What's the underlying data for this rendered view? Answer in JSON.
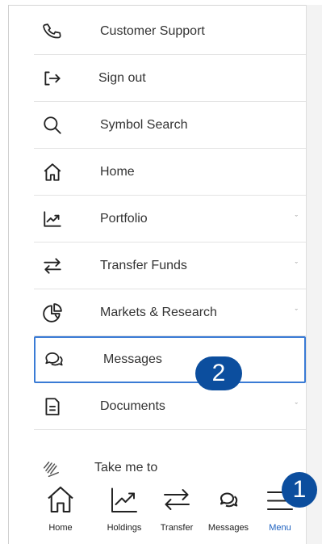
{
  "menu": {
    "items": [
      {
        "label": "Customer Support",
        "icon": "phone-icon",
        "chevron": false
      },
      {
        "label": "Sign out",
        "icon": "sign-out-icon",
        "chevron": false
      },
      {
        "label": "Symbol Search",
        "icon": "search-icon",
        "chevron": false
      },
      {
        "label": "Home",
        "icon": "home-icon",
        "chevron": false
      },
      {
        "label": "Portfolio",
        "icon": "chart-trend-icon",
        "chevron": true
      },
      {
        "label": "Transfer Funds",
        "icon": "transfer-arrows-icon",
        "chevron": true
      },
      {
        "label": "Markets & Research",
        "icon": "pie-chart-icon",
        "chevron": true
      },
      {
        "label": "Messages",
        "icon": "chat-bubbles-icon",
        "chevron": false,
        "highlighted": true
      },
      {
        "label": "Documents",
        "icon": "document-icon",
        "chevron": true
      }
    ],
    "chevron_glyph": "ˇ",
    "take_me_to": "Take me to"
  },
  "annotations": {
    "badge_1": "1",
    "badge_2": "2"
  },
  "bottom_nav": {
    "items": [
      {
        "label": "Home",
        "icon": "home-icon"
      },
      {
        "label": "Holdings",
        "icon": "chart-trend-icon"
      },
      {
        "label": "Transfer",
        "icon": "transfer-arrows-icon"
      },
      {
        "label": "Messages",
        "icon": "chat-bubbles-icon"
      },
      {
        "label": "Menu",
        "icon": "hamburger-icon",
        "active": true
      }
    ]
  },
  "colors": {
    "accent": "#1b5fbf",
    "badge": "#0c4e9e",
    "highlight_border": "#3a7bd5",
    "text": "#333333"
  }
}
